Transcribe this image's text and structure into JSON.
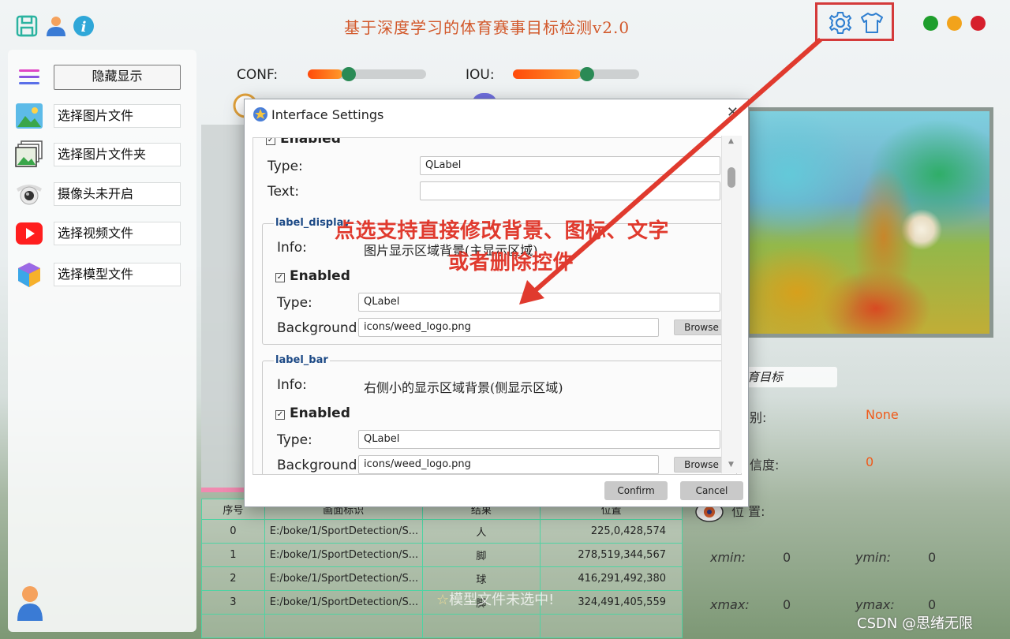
{
  "app": {
    "title": "基于深度学习的体育赛事目标检测v2.0",
    "watermark": "CSDN @思绪无限"
  },
  "window_controls": {
    "colors": [
      "#1e9e2c",
      "#f2a31b",
      "#d61f2c"
    ]
  },
  "sidebar": {
    "toggle_label": "隐藏显示",
    "items": [
      {
        "label": "选择图片文件",
        "icon": "image-icon"
      },
      {
        "label": "选择图片文件夹",
        "icon": "folder-images-icon"
      },
      {
        "label": "摄像头未开启",
        "icon": "camera-icon"
      },
      {
        "label": "选择视频文件",
        "icon": "video-icon"
      },
      {
        "label": "选择模型文件",
        "icon": "model-cubes-icon"
      }
    ]
  },
  "params": {
    "conf_label": "CONF:",
    "iou_label": "IOU:",
    "conf_value": 0.25,
    "iou_value": 0.5
  },
  "table": {
    "headers": [
      "序号",
      "画面标识",
      "结果",
      "位置"
    ],
    "rows": [
      [
        "0",
        "E:/boke/1/SportDetection/S...",
        "人",
        "225,0,428,574"
      ],
      [
        "1",
        "E:/boke/1/SportDetection/S...",
        "脚",
        "278,519,344,567"
      ],
      [
        "2",
        "E:/boke/1/SportDetection/S...",
        "球",
        "416,291,492,380"
      ],
      [
        "3",
        "E:/boke/1/SportDetection/S...",
        "脚",
        "324,491,405,559"
      ]
    ],
    "overlay_text": "模型文件未选中!"
  },
  "detail": {
    "target_label": "育目标",
    "class_label": "别:",
    "class_value": "None",
    "conf_label": "信度:",
    "conf_value": "0",
    "pos_label": "位 置:",
    "xmin_label": "xmin:",
    "xmin_value": "0",
    "ymin_label": "ymin:",
    "ymin_value": "0",
    "xmax_label": "xmax:",
    "xmax_value": "0",
    "ymax_label": "ymax:",
    "ymax_value": "0"
  },
  "dialog": {
    "title": "Interface Settings",
    "top": {
      "enabled": "Enabled",
      "type_label": "Type:",
      "type_value": "QLabel",
      "text_label": "Text:",
      "text_value": ""
    },
    "groups": [
      {
        "name": "label_display",
        "info_label": "Info:",
        "info": "图片显示区域背景(主显示区域)",
        "enabled": "Enabled",
        "type_label": "Type:",
        "type_value": "QLabel",
        "bg_label": "Background:",
        "bg_value": "icons/weed_logo.png",
        "browse": "Browse"
      },
      {
        "name": "label_bar",
        "info_label": "Info:",
        "info": "右侧小的显示区域背景(侧显示区域)",
        "enabled": "Enabled",
        "type_label": "Type:",
        "type_value": "QLabel",
        "bg_label": "Background:",
        "bg_value": "icons/weed_logo.png",
        "browse": "Browse"
      }
    ],
    "confirm": "Confirm",
    "cancel": "Cancel"
  },
  "annotation": {
    "line1": "点选支持直接修改背景、图标、文字",
    "line2": "或者删除控件",
    "color": "#e03a2e"
  }
}
